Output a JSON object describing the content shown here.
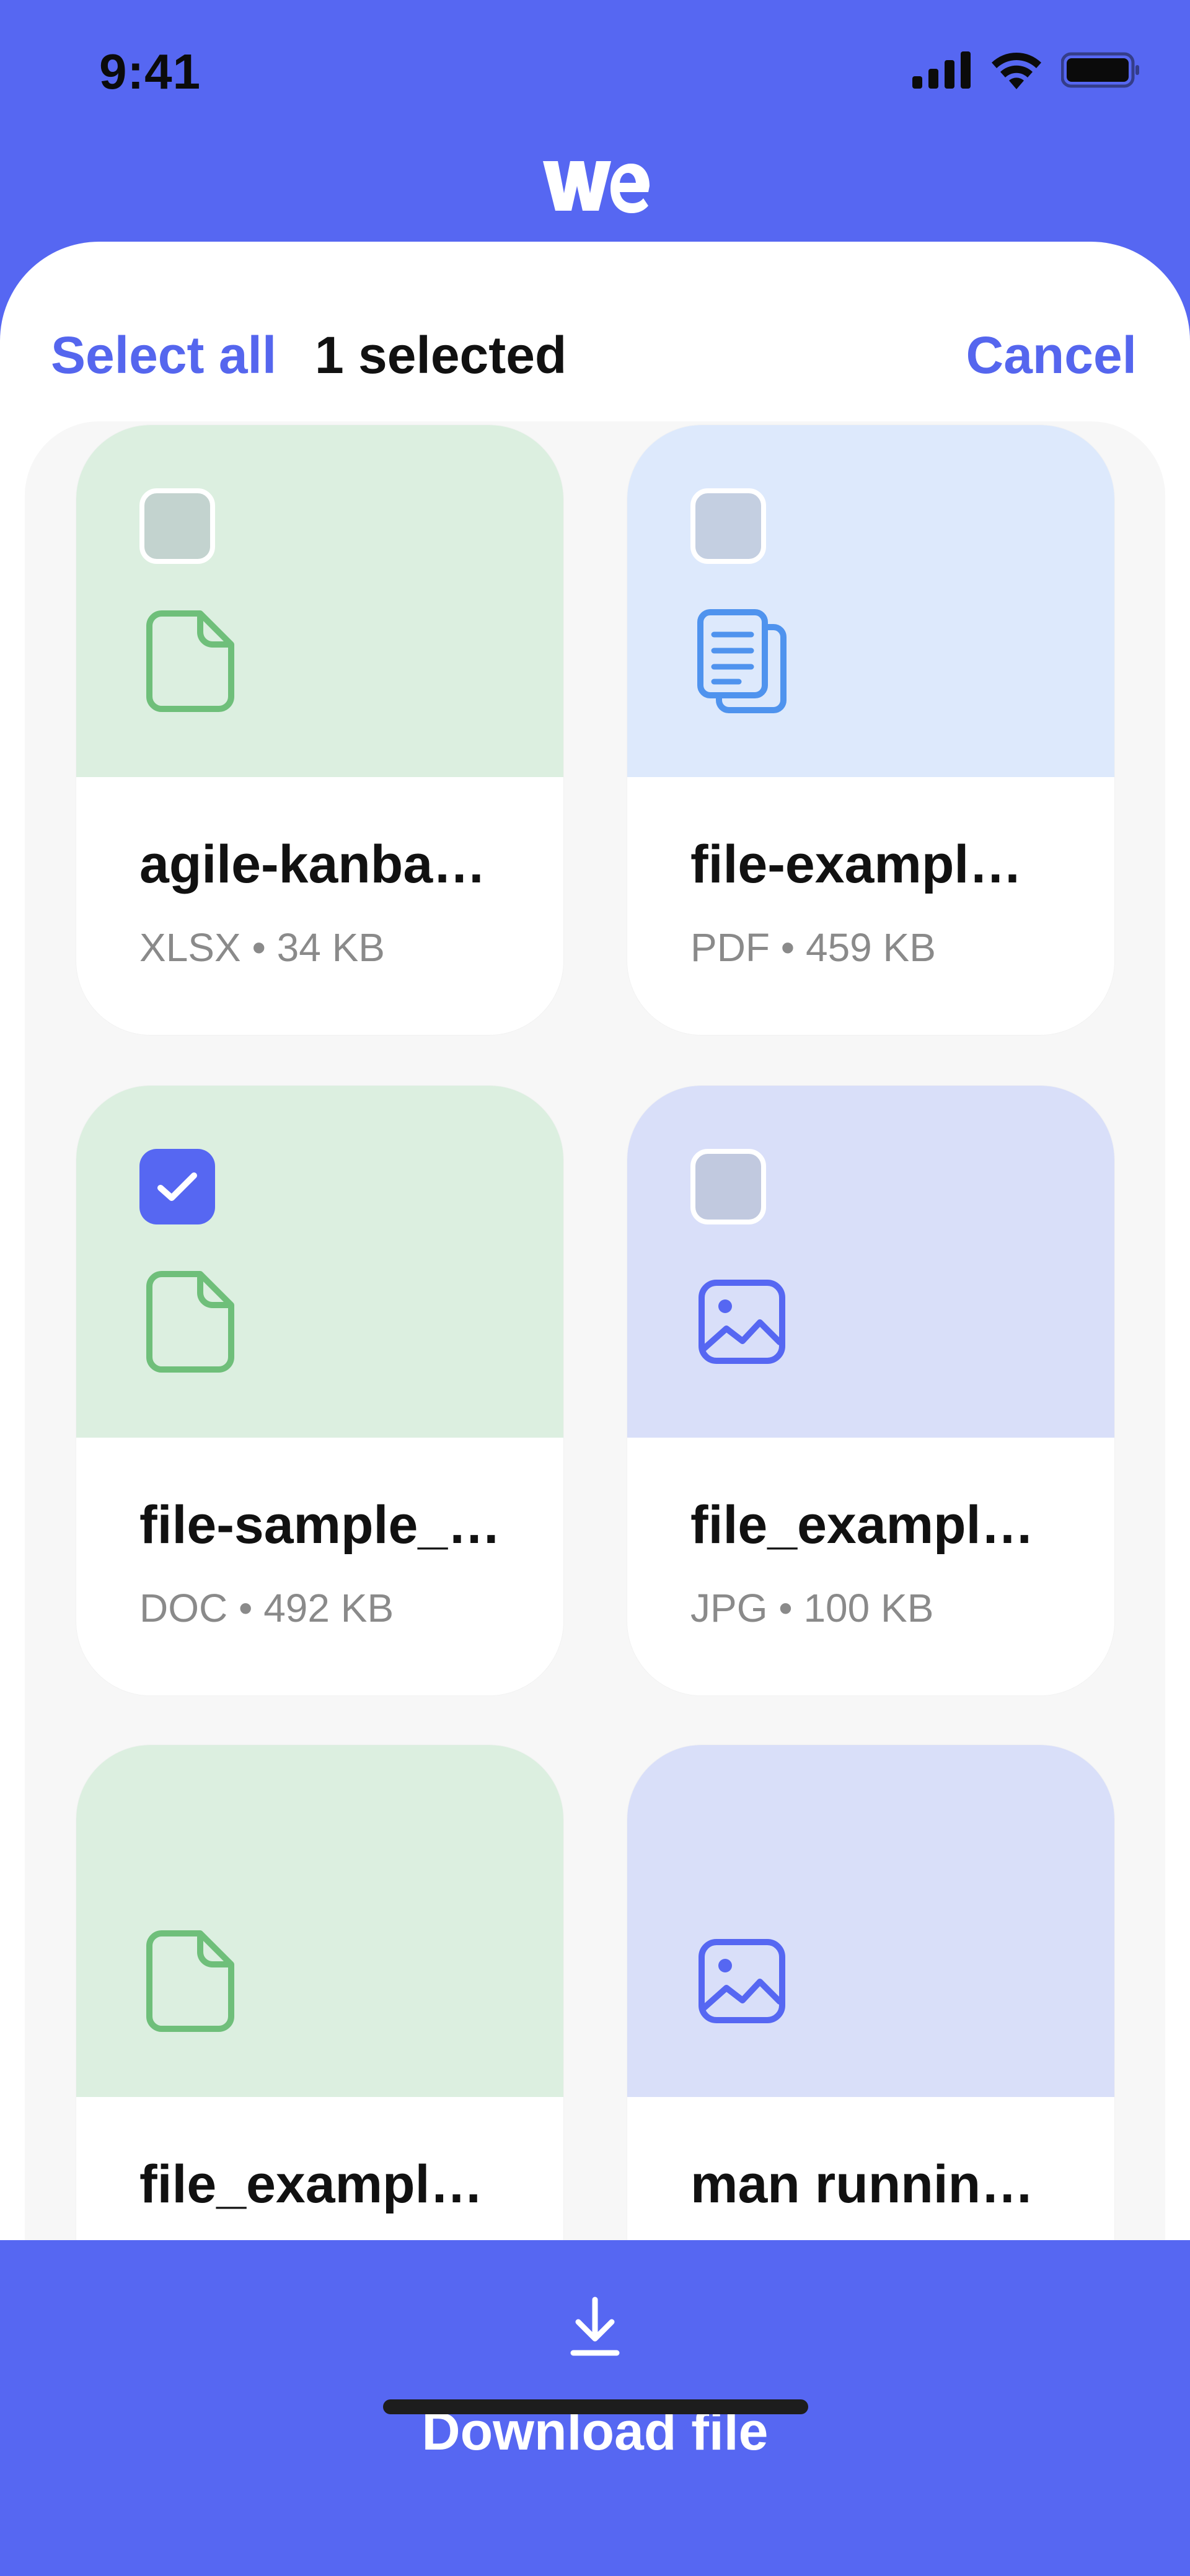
{
  "status": {
    "time": "9:41",
    "icons": [
      "cellular-signal-icon",
      "wifi-icon",
      "battery-icon"
    ]
  },
  "brand": {
    "logo_text": "we",
    "color": "#FFFFFF"
  },
  "header": {
    "select_all_label": "Select all",
    "selected_count": "1 selected",
    "cancel_label": "Cancel"
  },
  "files": [
    {
      "name": "agile-kanba…",
      "type": "XLSX",
      "size": "34 KB",
      "meta": "XLSX • 34 KB",
      "selected": false,
      "icon": "document-icon",
      "theme": "green"
    },
    {
      "name": "file-exampl…",
      "type": "PDF",
      "size": "459 KB",
      "meta": "PDF • 459 KB",
      "selected": false,
      "icon": "pdf-pages-icon",
      "theme": "lightblue"
    },
    {
      "name": "file-sample_…",
      "type": "DOC",
      "size": "492 KB",
      "meta": "DOC • 492 KB",
      "selected": true,
      "icon": "document-icon",
      "theme": "green"
    },
    {
      "name": "file_exampl…",
      "type": "JPG",
      "size": "100 KB",
      "meta": "JPG • 100 KB",
      "selected": false,
      "icon": "image-icon",
      "theme": "lavender"
    },
    {
      "name": "file_exampl…",
      "type": "",
      "size": "",
      "meta": "",
      "selected": false,
      "icon": "document-icon",
      "theme": "green"
    },
    {
      "name": "man runnin…",
      "type": "",
      "size": "",
      "meta": "",
      "selected": false,
      "icon": "image-icon",
      "theme": "lavender"
    }
  ],
  "footer": {
    "download_label": "Download file",
    "icon": "download-arrow-icon"
  },
  "colors": {
    "accent": "#5667F2",
    "green_tile": "#DCEFE0",
    "lightblue_tile": "#DDE9FC",
    "lavender_tile": "#D9DFF9"
  }
}
